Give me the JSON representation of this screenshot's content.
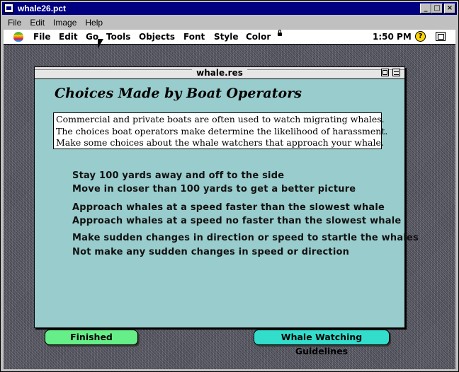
{
  "window": {
    "title": "whale26.pct",
    "minimize_glyph": "_",
    "maximize_glyph": "□",
    "close_glyph": "×"
  },
  "win_menu": [
    "File",
    "Edit",
    "Image",
    "Help"
  ],
  "mac_menu": {
    "items": [
      "File",
      "Edit",
      "Go",
      "Tools",
      "Objects",
      "Font",
      "Style",
      "Color"
    ],
    "clock": "1:50 PM",
    "help_glyph": "?"
  },
  "mac_window": {
    "title": "whale.res"
  },
  "page": {
    "heading": "Choices  Made by Boat Operators",
    "intro_lines": [
      "Commercial and private boats are often used to watch migrating whales.",
      "The choices boat operators make determine the likelihood of harassment.",
      "Make some choices about the whale watchers that approach your whale."
    ],
    "choices": [
      "Stay 100 yards away and off to the side",
      "Move in closer than 100 yards to get a better picture",
      "Approach whales at a speed faster than the slowest whale",
      "Approach whales at a speed no faster than the slowest whale",
      "Make sudden changes in direction or speed to startle the whales",
      "Not make any sudden changes in speed or direction"
    ],
    "finished_label": "Finished",
    "guidelines_label": "Whale Watching Guidelines"
  },
  "icons": {
    "apple": "apple-icon",
    "lock": "lock-icon",
    "help": "help-balloon-icon",
    "app_switcher": "application-menu-icon",
    "cursor": "mouse-pointer-icon"
  },
  "colors": {
    "win_titlebar": "#000080",
    "mac_window_bg": "#99cccc",
    "finished_button": "#66ee88",
    "guidelines_button": "#33ddcc"
  }
}
